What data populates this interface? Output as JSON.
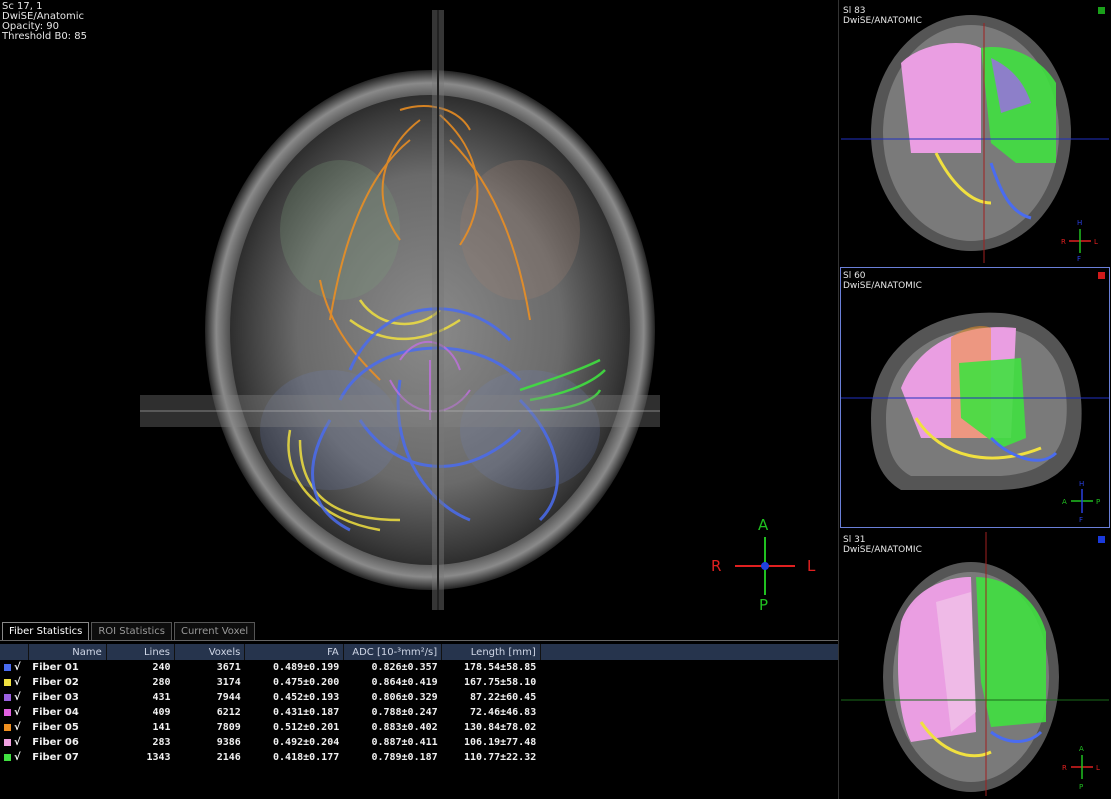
{
  "main_view": {
    "overlay": [
      "Sc 17, 1",
      "DwiSE/Anatomic",
      "Opacity: 90",
      "Threshold B0: 85"
    ],
    "orientation": {
      "top": "A",
      "bottom": "P",
      "left": "R",
      "right": "L"
    },
    "corner_mark": "◄"
  },
  "views": [
    {
      "label1": "Sl 83",
      "label2": "DwiSE/ANATOMIC",
      "marker_color": "#1aa01a",
      "orientation": {
        "top": "H",
        "bottom": "F",
        "left": "R",
        "right": "L"
      }
    },
    {
      "label1": "Sl 60",
      "label2": "DwiSE/ANATOMIC",
      "marker_color": "#d01a1a",
      "orientation": {
        "top": "H",
        "bottom": "F",
        "left": "A",
        "right": "P"
      }
    },
    {
      "label1": "Sl 31",
      "label2": "DwiSE/ANATOMIC",
      "marker_color": "#1a3adc",
      "orientation": {
        "top": "A",
        "bottom": "P",
        "left": "R",
        "right": "L"
      }
    }
  ],
  "stats": {
    "tabs": [
      "Fiber Statistics",
      "ROI Statistics",
      "Current Voxel"
    ],
    "columns": [
      "Name",
      "Lines",
      "Voxels",
      "FA",
      "ADC [10-³mm²/s]",
      "Length [mm]"
    ],
    "rows": [
      {
        "color": "#4a6cf0",
        "check": "√",
        "name": "Fiber 01",
        "lines": "240",
        "voxels": "3671",
        "fa": "0.489±0.199",
        "adc": "0.826±0.357",
        "length": "178.54±58.85"
      },
      {
        "color": "#f0e040",
        "check": "√",
        "name": "Fiber 02",
        "lines": "280",
        "voxels": "3174",
        "fa": "0.475±0.200",
        "adc": "0.864±0.419",
        "length": "167.75±58.10"
      },
      {
        "color": "#9a60e0",
        "check": "√",
        "name": "Fiber 03",
        "lines": "431",
        "voxels": "7944",
        "fa": "0.452±0.193",
        "adc": "0.806±0.329",
        "length": "87.22±60.45"
      },
      {
        "color": "#e060e0",
        "check": "√",
        "name": "Fiber 04",
        "lines": "409",
        "voxels": "6212",
        "fa": "0.431±0.187",
        "adc": "0.788±0.247",
        "length": "72.46±46.83"
      },
      {
        "color": "#f09020",
        "check": "√",
        "name": "Fiber 05",
        "lines": "141",
        "voxels": "7809",
        "fa": "0.512±0.201",
        "adc": "0.883±0.402",
        "length": "130.84±78.02"
      },
      {
        "color": "#f0a0e0",
        "check": "√",
        "name": "Fiber 06",
        "lines": "283",
        "voxels": "9386",
        "fa": "0.492±0.204",
        "adc": "0.887±0.411",
        "length": "106.19±77.48"
      },
      {
        "color": "#40e040",
        "check": "√",
        "name": "Fiber 07",
        "lines": "1343",
        "voxels": "2146",
        "fa": "0.418±0.177",
        "adc": "0.789±0.187",
        "length": "110.77±22.32"
      }
    ]
  }
}
